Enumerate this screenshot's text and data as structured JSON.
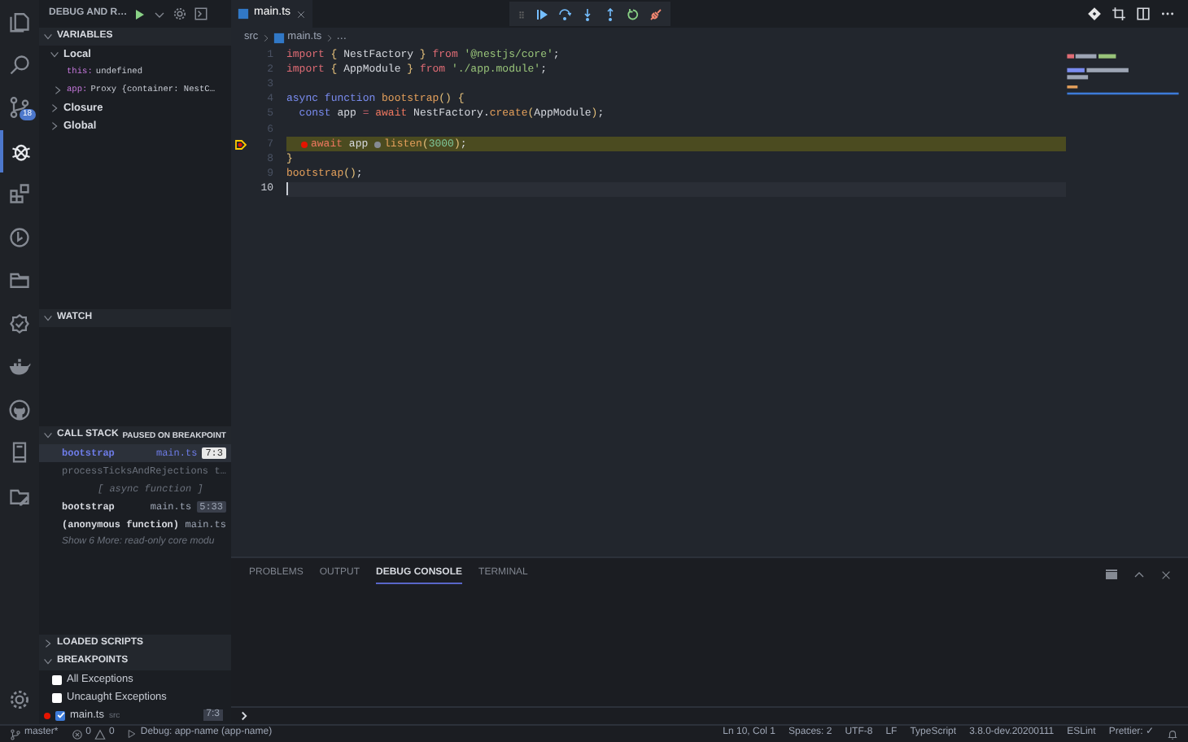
{
  "activity_bar": {
    "items": [
      {
        "kind": "files",
        "selected": false
      },
      {
        "kind": "search",
        "selected": false
      },
      {
        "kind": "source-control",
        "selected": false,
        "badge": "18"
      },
      {
        "kind": "debug",
        "selected": true
      },
      {
        "kind": "extensions",
        "selected": false
      },
      {
        "kind": "timeline",
        "selected": false
      },
      {
        "kind": "folder",
        "selected": false
      },
      {
        "kind": "verified",
        "selected": false
      },
      {
        "kind": "docker",
        "selected": false
      },
      {
        "kind": "github",
        "selected": false
      },
      {
        "kind": "device",
        "selected": false
      },
      {
        "kind": "edit",
        "selected": false
      }
    ]
  },
  "debug_toolbar": {
    "config": "DEBUG AND R…"
  },
  "sidebar": {
    "variables": {
      "title": "VARIABLES",
      "expanded": true,
      "items": [
        {
          "label": "Local",
          "expanded": true,
          "children": [
            {
              "name": "this:",
              "value": "undefined"
            },
            {
              "name": "app:",
              "value": "Proxy {container: NestC…",
              "expanded": false
            }
          ]
        },
        {
          "label": "Closure",
          "expanded": false
        },
        {
          "label": "Global",
          "expanded": false
        }
      ]
    },
    "watch": {
      "title": "WATCH",
      "expanded": true
    },
    "call_stack": {
      "title": "CALL STACK",
      "status": "PAUSED ON BREAKPOINT",
      "expanded": true,
      "frames": [
        {
          "kind": "frame",
          "name": "bootstrap",
          "file": "main.ts",
          "position": "7:3",
          "selected": true,
          "dimmed": false
        },
        {
          "kind": "frame",
          "name": "processTicksAndRejections",
          "file": "t…",
          "selected": false,
          "dimmed": true
        },
        {
          "kind": "label",
          "text": "[ async function ]"
        },
        {
          "kind": "frame",
          "name": "bootstrap",
          "file": "main.ts",
          "position": "5:33",
          "selected": false,
          "dimmed": false
        },
        {
          "kind": "frame",
          "name": "(anonymous function)",
          "file": "main.ts",
          "selected": false,
          "dimmed": false
        },
        {
          "kind": "more",
          "text": "Show 6 More: read-only core modu"
        }
      ]
    },
    "loaded_scripts": {
      "title": "LOADED SCRIPTS",
      "expanded": false
    },
    "breakpoints": {
      "title": "BREAKPOINTS",
      "expanded": true,
      "items": [
        {
          "label": "All Exceptions",
          "checked": false
        },
        {
          "label": "Uncaught Exceptions",
          "checked": false
        },
        {
          "label": "main.ts",
          "path": "src",
          "position": "7:3",
          "checked": true,
          "verified": true
        }
      ]
    }
  },
  "editor": {
    "tabs": [
      {
        "label": "main.ts",
        "selected": true
      }
    ],
    "breadcrumbs": [
      "src",
      "main.ts",
      "…"
    ],
    "lines": [
      {
        "number": "1",
        "kind": "normal",
        "tokens": [
          {
            "kind": "k1",
            "text": "import"
          },
          {
            "kind": "p",
            "text": " {"
          },
          {
            "kind": "id",
            "text": " NestFactory"
          },
          {
            "kind": "p",
            "text": " }"
          },
          {
            "kind": "k1",
            "text": " from"
          },
          {
            "kind": "s",
            "text": " '@nestjs/core'"
          },
          {
            "kind": "id",
            "text": ";"
          }
        ]
      },
      {
        "number": "2",
        "kind": "normal",
        "tokens": [
          {
            "kind": "k1",
            "text": "import"
          },
          {
            "kind": "p",
            "text": " {"
          },
          {
            "kind": "id",
            "text": " AppModule"
          },
          {
            "kind": "p",
            "text": " }"
          },
          {
            "kind": "k1",
            "text": " from"
          },
          {
            "kind": "s",
            "text": " './app.module'"
          },
          {
            "kind": "id",
            "text": ";"
          }
        ]
      },
      {
        "number": "3",
        "kind": "normal"
      },
      {
        "number": "4",
        "kind": "normal",
        "tokens": [
          {
            "kind": "k2",
            "text": "async"
          },
          {
            "kind": "k2",
            "text": " function"
          },
          {
            "kind": "fn",
            "text": " bootstrap"
          },
          {
            "kind": "p",
            "text": "() {"
          }
        ]
      },
      {
        "number": "5",
        "kind": "normal",
        "tokens": [
          {
            "kind": "k2",
            "text": "  const"
          },
          {
            "kind": "id",
            "text": " app "
          },
          {
            "kind": "k1",
            "text": "="
          },
          {
            "kind": "aw",
            "text": " await"
          },
          {
            "kind": "id",
            "text": " NestFactory."
          },
          {
            "kind": "fn",
            "text": "create"
          },
          {
            "kind": "p",
            "text": "("
          },
          {
            "kind": "id",
            "text": "AppModule"
          },
          {
            "kind": "p",
            "text": ")"
          },
          {
            "kind": "id",
            "text": ";"
          }
        ]
      },
      {
        "number": "6",
        "kind": "normal"
      },
      {
        "number": "7",
        "kind": "paused",
        "tokens": [
          {
            "kind": "bp"
          },
          {
            "kind": "aw",
            "text": "await"
          },
          {
            "kind": "id",
            "text": " app "
          },
          {
            "kind": "dot"
          },
          {
            "kind": "fn",
            "text": "listen"
          },
          {
            "kind": "p",
            "text": "("
          },
          {
            "kind": "n",
            "text": "3000"
          },
          {
            "kind": "p",
            "text": ")"
          },
          {
            "kind": "id",
            "text": ";"
          }
        ]
      },
      {
        "number": "8",
        "kind": "normal",
        "tokens": [
          {
            "kind": "p",
            "text": "}"
          }
        ]
      },
      {
        "number": "9",
        "kind": "normal",
        "tokens": [
          {
            "kind": "fn",
            "text": "bootstrap"
          },
          {
            "kind": "p",
            "text": "()"
          },
          {
            "kind": "id",
            "text": ";"
          }
        ]
      },
      {
        "number": "10",
        "kind": "cursor"
      }
    ]
  },
  "panel": {
    "tabs": [
      {
        "label": "PROBLEMS",
        "selected": false
      },
      {
        "label": "OUTPUT",
        "selected": false
      },
      {
        "label": "DEBUG CONSOLE",
        "selected": true
      },
      {
        "label": "TERMINAL",
        "selected": false
      }
    ]
  },
  "status_bar": {
    "branch": "master*",
    "errors": "0",
    "warnings": "0",
    "debug": "Debug: app-name (app-name)",
    "items": [
      "Ln 10, Col 1",
      "Spaces: 2",
      "UTF-8",
      "LF",
      "TypeScript",
      "3.8.0-dev.20200111",
      "ESLint",
      "Prettier: ✓"
    ]
  }
}
